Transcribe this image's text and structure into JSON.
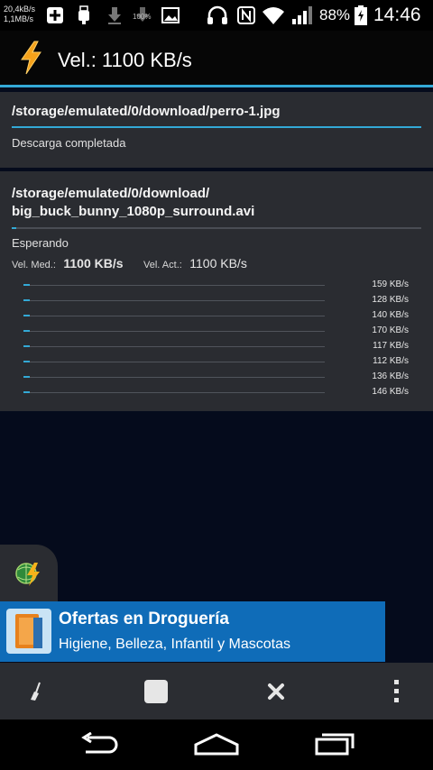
{
  "status_bar": {
    "net_up": "20,4kB/s",
    "net_down": "1,1MB/s",
    "battery_pct": "88%",
    "time": "14:46",
    "icons": [
      "plus-icon",
      "usb-icon",
      "download-icon",
      "download-100-icon",
      "download-icon",
      "image-icon",
      "headset-icon",
      "nfc-icon",
      "wifi-icon",
      "signal-icon",
      "battery-charging-icon"
    ]
  },
  "action_bar": {
    "title": "Vel.: 1100 KB/s",
    "logo": "lightning-bolt-icon"
  },
  "downloads": [
    {
      "path": "/storage/emulated/0/download/perro-1.jpg",
      "progress": 1.0,
      "status": "Descarga completada"
    },
    {
      "path_line1": "/storage/emulated/0/download/",
      "path_line2": "big_buck_bunny_1080p_surround.avi",
      "progress": 0.01,
      "status": "Esperando",
      "avg_label": "Vel. Med.:",
      "avg_value": "1100 KB/s",
      "cur_label": "Vel. Act.:",
      "cur_value": "1100 KB/s",
      "threads": [
        {
          "speed": "159 KB/s",
          "progress": 0.02
        },
        {
          "speed": "128 KB/s",
          "progress": 0.02
        },
        {
          "speed": "140 KB/s",
          "progress": 0.02
        },
        {
          "speed": "170 KB/s",
          "progress": 0.02
        },
        {
          "speed": "117 KB/s",
          "progress": 0.02
        },
        {
          "speed": "112 KB/s",
          "progress": 0.02
        },
        {
          "speed": "136 KB/s",
          "progress": 0.02
        },
        {
          "speed": "146 KB/s",
          "progress": 0.02
        }
      ]
    }
  ],
  "ad": {
    "title": "Ofertas en Droguería",
    "subtitle": "Higiene, Belleza, Infantil y Mascotas"
  },
  "toolbar": {
    "buttons": [
      "broom-icon",
      "stop-icon",
      "close-icon",
      "overflow-menu-icon"
    ]
  },
  "navbar": {
    "buttons": [
      "back-icon",
      "home-icon",
      "recent-apps-icon"
    ]
  },
  "colors": {
    "accent": "#33a9d6",
    "card": "#2a2c31",
    "background": "#050b1c",
    "ad": "#0f6cb8"
  }
}
